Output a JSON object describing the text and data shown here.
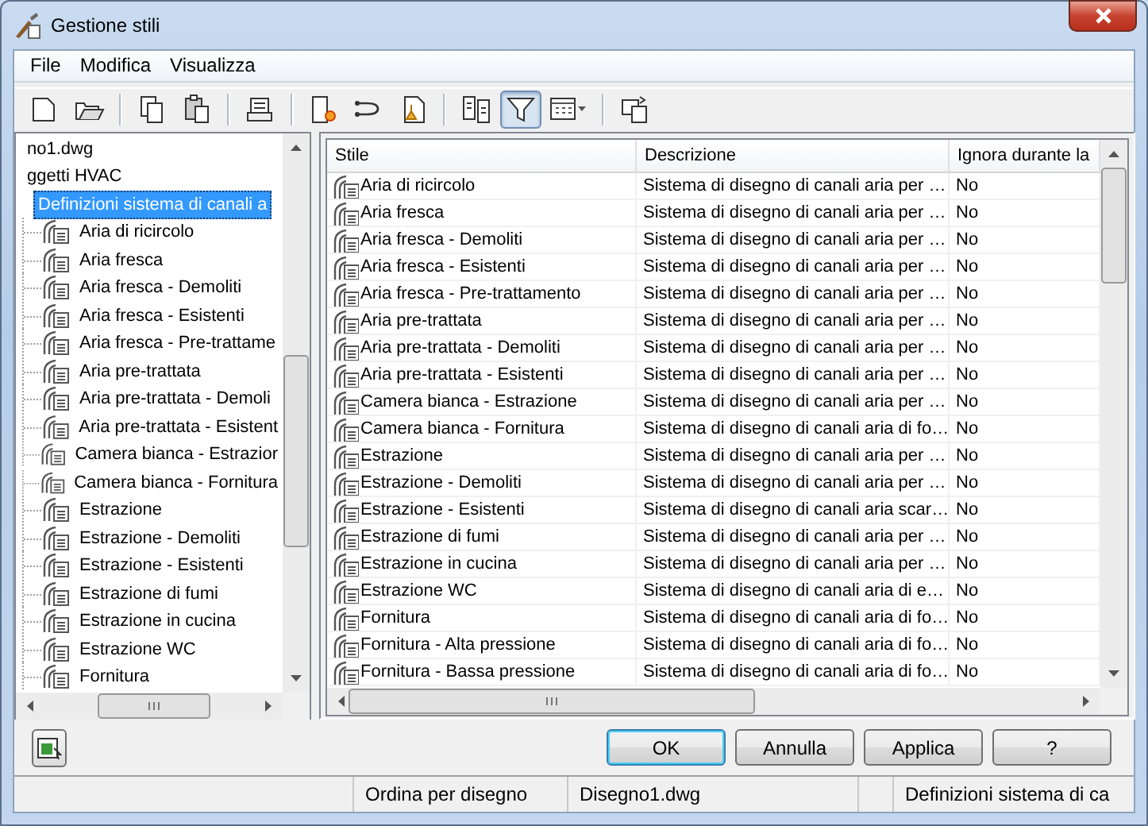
{
  "window": {
    "title": "Gestione stili"
  },
  "menu": [
    "File",
    "Modifica",
    "Visualizza"
  ],
  "toolbar": [
    [
      {
        "kind": "new",
        "pressed": false
      },
      {
        "kind": "open",
        "pressed": false
      }
    ],
    [
      {
        "kind": "copy",
        "pressed": false
      },
      {
        "kind": "paste",
        "pressed": false
      }
    ],
    [
      {
        "kind": "edit",
        "pressed": false
      }
    ],
    [
      {
        "kind": "newstyle",
        "pressed": false
      },
      {
        "kind": "cycle",
        "pressed": false
      },
      {
        "kind": "purge",
        "pressed": false
      }
    ],
    [
      {
        "kind": "compare",
        "pressed": false
      },
      {
        "kind": "filter",
        "pressed": true
      },
      {
        "kind": "view",
        "pressed": false
      }
    ],
    [
      {
        "kind": "sync",
        "pressed": false
      }
    ]
  ],
  "tree": [
    {
      "label": "no1.dwg",
      "selected": false,
      "children": [
        {
          "label": "ggetti HVAC",
          "selected": false,
          "children": [
            {
              "label": "Definizioni sistema di canali a",
              "selected": true,
              "children": [
                {
                  "label": "Aria di ricircolo",
                  "selected": false
                },
                {
                  "label": "Aria fresca",
                  "selected": false
                },
                {
                  "label": "Aria fresca - Demoliti",
                  "selected": false
                },
                {
                  "label": "Aria fresca - Esistenti",
                  "selected": false
                },
                {
                  "label": "Aria fresca - Pre-trattame",
                  "selected": false
                },
                {
                  "label": "Aria pre-trattata",
                  "selected": false
                },
                {
                  "label": "Aria pre-trattata - Demoli",
                  "selected": false
                },
                {
                  "label": "Aria pre-trattata - Esistent",
                  "selected": false
                },
                {
                  "label": "Camera bianca - Estrazior",
                  "selected": false
                },
                {
                  "label": "Camera bianca - Fornitura",
                  "selected": false
                },
                {
                  "label": "Estrazione",
                  "selected": false
                },
                {
                  "label": "Estrazione - Demoliti",
                  "selected": false
                },
                {
                  "label": "Estrazione - Esistenti",
                  "selected": false
                },
                {
                  "label": "Estrazione di fumi",
                  "selected": false
                },
                {
                  "label": "Estrazione in cucina",
                  "selected": false
                },
                {
                  "label": "Estrazione WC",
                  "selected": false
                },
                {
                  "label": "Fornitura",
                  "selected": false
                }
              ]
            }
          ]
        }
      ]
    }
  ],
  "table": {
    "columns": [
      "Stile",
      "Descrizione",
      "Ignora durante la"
    ],
    "rows": [
      {
        "style": "Aria di ricircolo",
        "description": "Sistema di disegno di canali aria per …",
        "ignore": "No"
      },
      {
        "style": "Aria fresca",
        "description": "Sistema di disegno di canali aria per …",
        "ignore": "No"
      },
      {
        "style": "Aria fresca - Demoliti",
        "description": "Sistema di disegno di canali aria per …",
        "ignore": "No"
      },
      {
        "style": "Aria fresca - Esistenti",
        "description": "Sistema di disegno di canali aria per …",
        "ignore": "No"
      },
      {
        "style": "Aria fresca - Pre-trattamento",
        "description": "Sistema di disegno di canali aria per …",
        "ignore": "No"
      },
      {
        "style": "Aria pre-trattata",
        "description": "Sistema di disegno di canali aria per …",
        "ignore": "No"
      },
      {
        "style": "Aria pre-trattata - Demoliti",
        "description": "Sistema di disegno di canali aria per …",
        "ignore": "No"
      },
      {
        "style": "Aria pre-trattata - Esistenti",
        "description": "Sistema di disegno di canali aria per …",
        "ignore": "No"
      },
      {
        "style": "Camera bianca - Estrazione",
        "description": "Sistema di disegno di canali aria per …",
        "ignore": "No"
      },
      {
        "style": "Camera bianca - Fornitura",
        "description": "Sistema di disegno di canali aria di fo…",
        "ignore": "No"
      },
      {
        "style": "Estrazione",
        "description": "Sistema di disegno di canali aria per …",
        "ignore": "No"
      },
      {
        "style": "Estrazione - Demoliti",
        "description": "Sistema di disegno di canali aria per …",
        "ignore": "No"
      },
      {
        "style": "Estrazione - Esistenti",
        "description": "Sistema di disegno di canali aria scar…",
        "ignore": "No"
      },
      {
        "style": "Estrazione di fumi",
        "description": "Sistema di disegno di canali aria per …",
        "ignore": "No"
      },
      {
        "style": "Estrazione in cucina",
        "description": "Sistema di disegno di canali aria per …",
        "ignore": "No"
      },
      {
        "style": "Estrazione WC",
        "description": "Sistema di disegno di canali aria di e…",
        "ignore": "No"
      },
      {
        "style": "Fornitura",
        "description": "Sistema di disegno di canali aria di fo…",
        "ignore": "No"
      },
      {
        "style": "Fornitura - Alta pressione",
        "description": "Sistema di disegno di canali aria di fo…",
        "ignore": "No"
      },
      {
        "style": "Fornitura - Bassa pressione",
        "description": "Sistema di disegno di canali aria di fo…",
        "ignore": "No"
      }
    ]
  },
  "buttons": [
    {
      "label": "OK",
      "default": true
    },
    {
      "label": "Annulla",
      "default": false
    },
    {
      "label": "Applica",
      "default": false
    },
    {
      "label": "?",
      "default": false
    }
  ],
  "status_bar": [
    "Ordina per disegno",
    "Disegno1.dwg",
    "Definizioni sistema di ca"
  ]
}
